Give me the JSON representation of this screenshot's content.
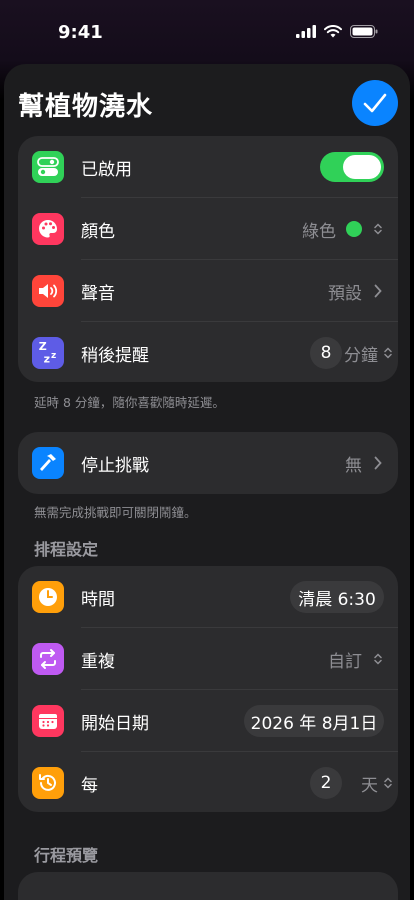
{
  "status": {
    "time": "9:41"
  },
  "header": {
    "title": "幫植物澆水"
  },
  "main_card": {
    "enabled_label": "已啟用",
    "color_label": "顏色",
    "color_value": "綠色",
    "color_dot": "#30d158",
    "sound_label": "聲音",
    "sound_value": "預設",
    "snooze_label": "稍後提醒",
    "snooze_minutes": "8",
    "snooze_unit": "分鐘"
  },
  "snooze_note": "延時 8 分鐘，隨你喜歡隨時延遲。",
  "challenge_card": {
    "label": "停止挑戰",
    "value": "無"
  },
  "challenge_note": "無需完成挑戰即可關閉鬧鐘。",
  "schedule": {
    "header": "排程設定",
    "time_label": "時間",
    "time_value": "清晨 6:30",
    "repeat_label": "重複",
    "repeat_value": "自訂",
    "start_label": "開始日期",
    "start_value": "2026 年 8月1日",
    "every_label": "每",
    "every_count": "2",
    "every_unit": "天"
  },
  "preview": {
    "header": "行程預覽"
  },
  "colors": {
    "accent": "#0a84ff",
    "toggle_on": "#30d158"
  }
}
